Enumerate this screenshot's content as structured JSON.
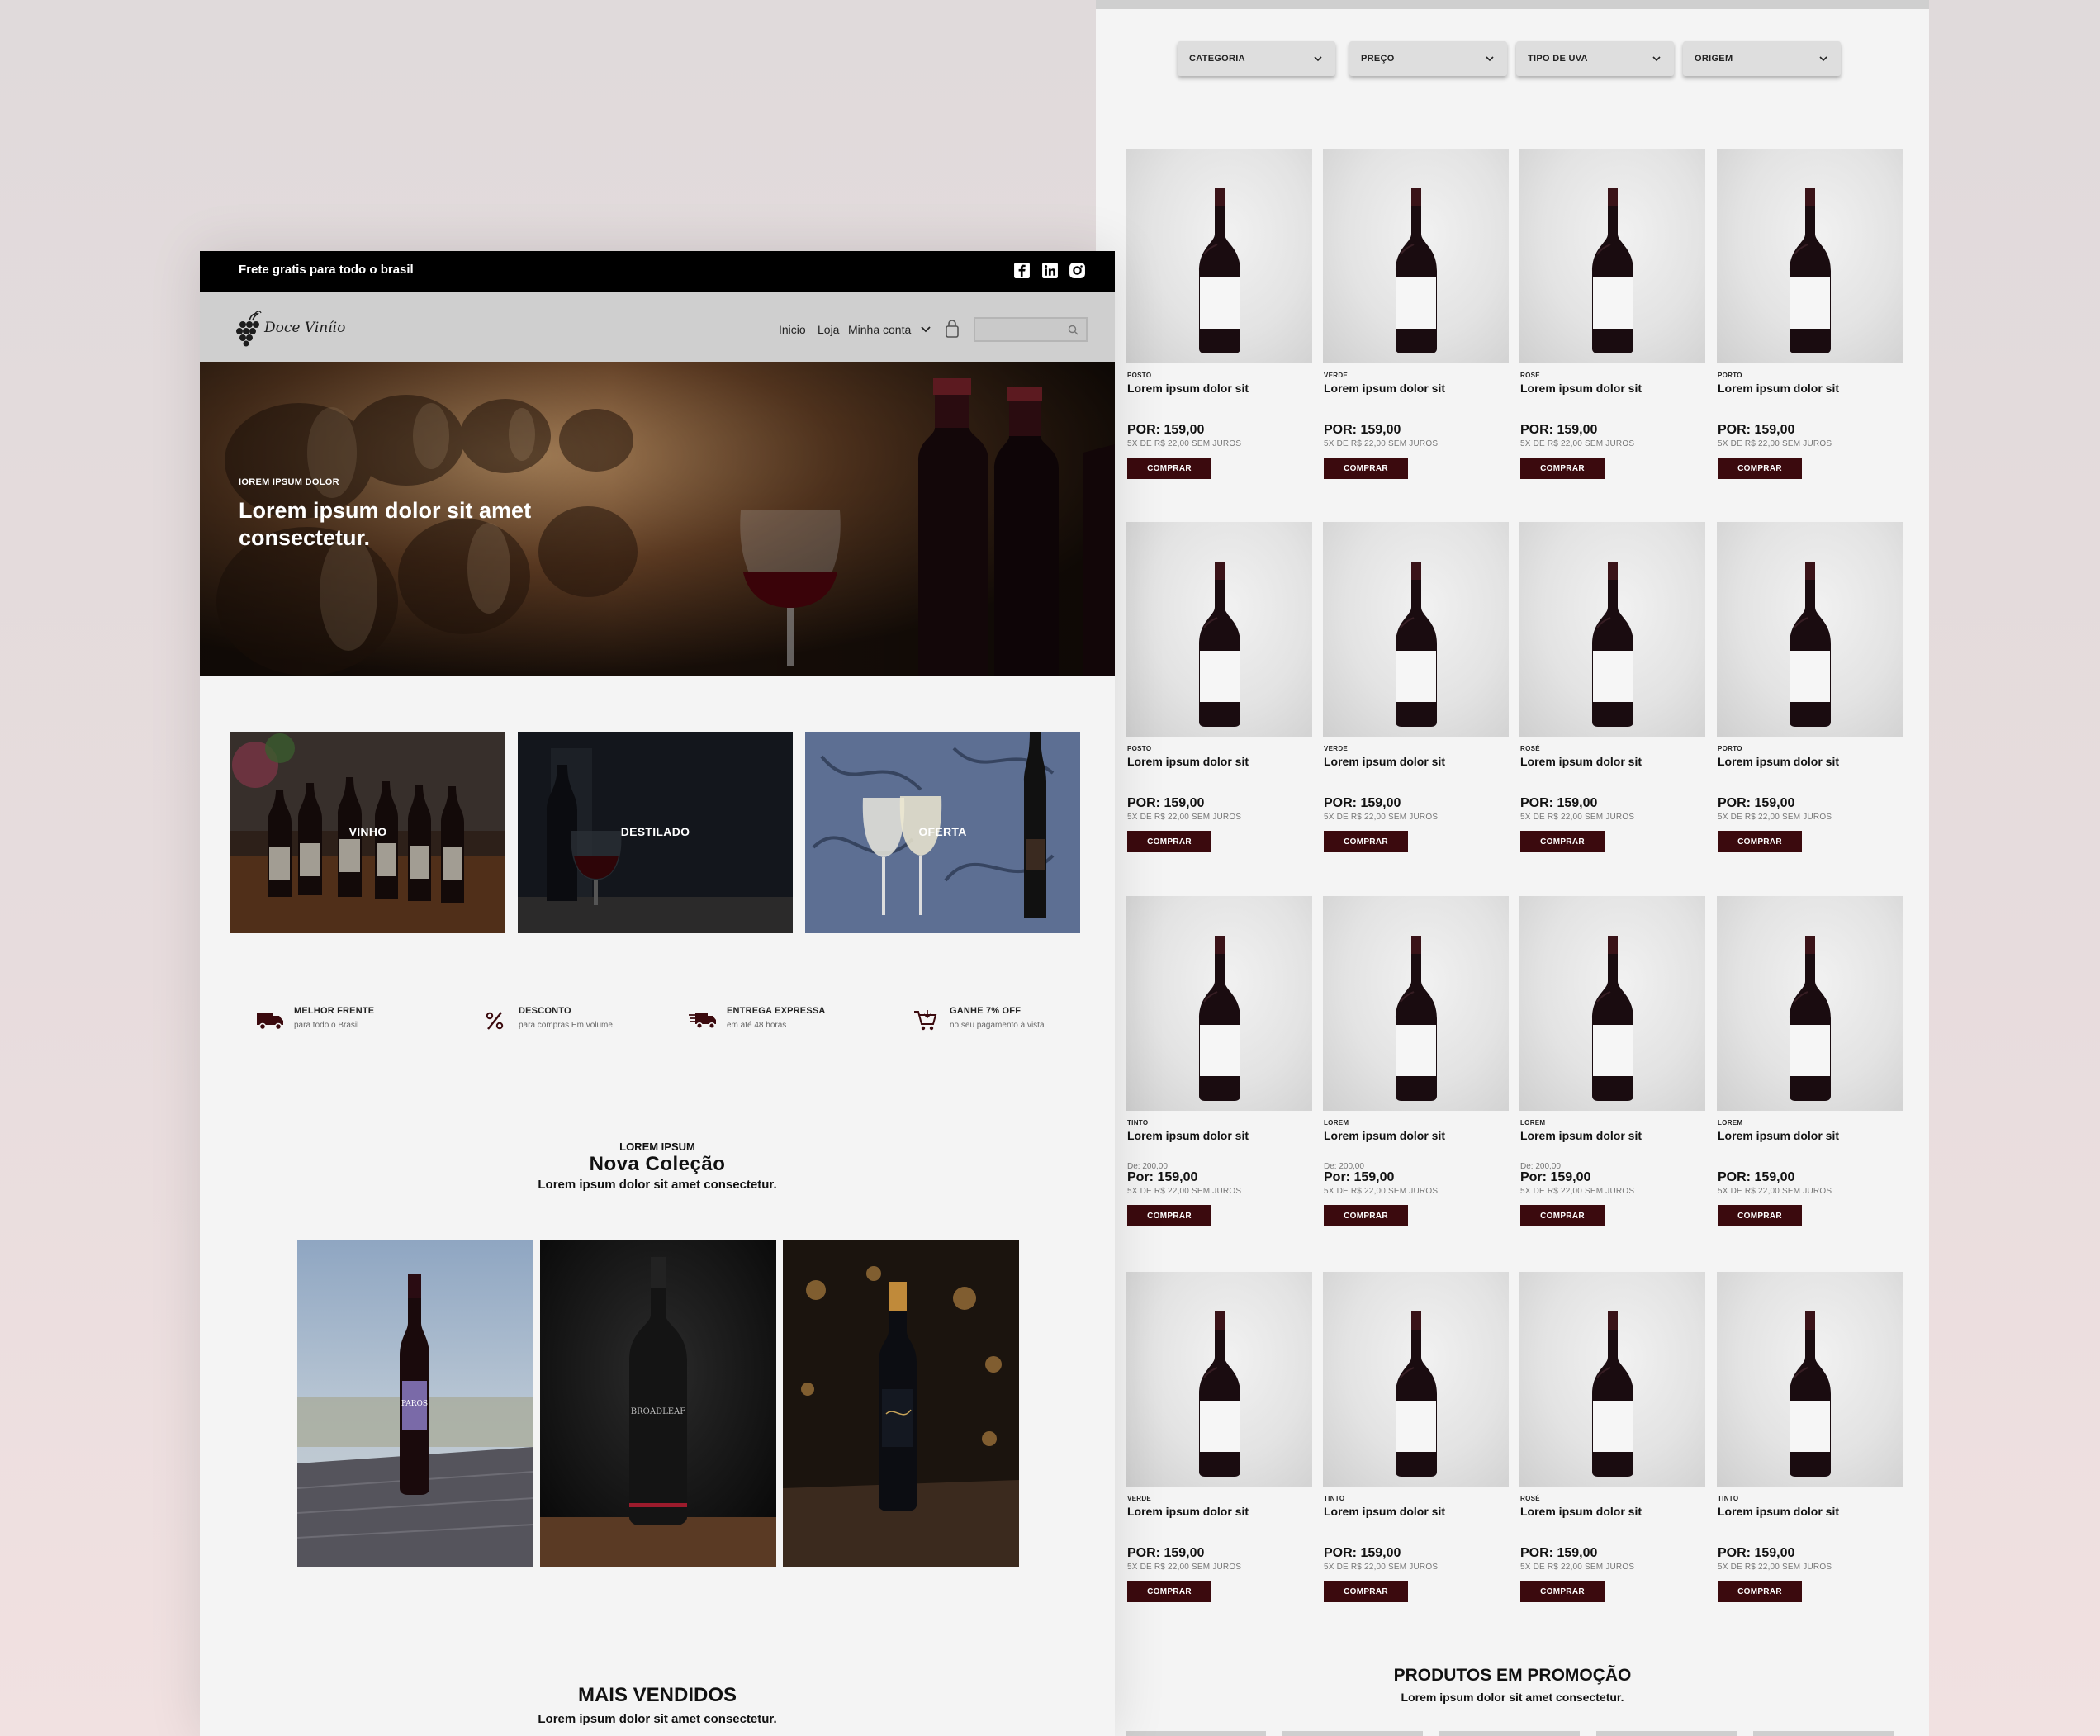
{
  "shop": {
    "filters": [
      {
        "label": "CATEGORIA"
      },
      {
        "label": "PREÇO"
      },
      {
        "label": "TIPO DE UVA"
      },
      {
        "label": "ORIGEM"
      }
    ],
    "buy_label": "COMPRAR",
    "installments": "5X DE R$ 22,00 SEM JUROS",
    "products": [
      {
        "category": "POSTO",
        "name": "Lorem ipsum dolor sit",
        "old_price": "",
        "price": "POR: 159,00"
      },
      {
        "category": "VERDE",
        "name": "Lorem ipsum dolor sit",
        "old_price": "",
        "price": "POR: 159,00"
      },
      {
        "category": "ROSÉ",
        "name": "Lorem ipsum dolor sit",
        "old_price": "",
        "price": "POR: 159,00"
      },
      {
        "category": "PORTO",
        "name": "Lorem ipsum dolor sit",
        "old_price": "",
        "price": "POR: 159,00"
      },
      {
        "category": "POSTO",
        "name": "Lorem ipsum dolor sit",
        "old_price": "",
        "price": "POR: 159,00"
      },
      {
        "category": "VERDE",
        "name": "Lorem ipsum dolor sit",
        "old_price": "",
        "price": "POR: 159,00"
      },
      {
        "category": "ROSÉ",
        "name": "Lorem ipsum dolor sit",
        "old_price": "",
        "price": "POR: 159,00"
      },
      {
        "category": "PORTO",
        "name": "Lorem ipsum dolor sit",
        "old_price": "",
        "price": "POR: 159,00"
      },
      {
        "category": "TINTO",
        "name": "Lorem ipsum dolor sit",
        "old_price": "De: 200,00",
        "price": "Por: 159,00"
      },
      {
        "category": "LOREM",
        "name": "Lorem ipsum dolor sit",
        "old_price": "De: 200,00",
        "price": "Por: 159,00"
      },
      {
        "category": "LOREM",
        "name": "Lorem ipsum dolor sit",
        "old_price": "De: 200,00",
        "price": "Por: 159,00"
      },
      {
        "category": "LOREM",
        "name": "Lorem ipsum dolor sit",
        "old_price": "",
        "price": "POR: 159,00"
      },
      {
        "category": "VERDE",
        "name": "Lorem ipsum dolor sit",
        "old_price": "",
        "price": "POR: 159,00"
      },
      {
        "category": "TINTO",
        "name": "Lorem ipsum dolor sit",
        "old_price": "",
        "price": "POR: 159,00"
      },
      {
        "category": "ROSÉ",
        "name": "Lorem ipsum dolor sit",
        "old_price": "",
        "price": "POR: 159,00"
      },
      {
        "category": "TINTO",
        "name": "Lorem ipsum dolor sit",
        "old_price": "",
        "price": "POR: 159,00"
      }
    ],
    "promo": {
      "title": "PRODUTOS EM PROMOÇÃO",
      "subtitle": "Lorem ipsum dolor sit amet consectetur."
    }
  },
  "home": {
    "topbar": {
      "text": "Frete gratis para todo o brasil",
      "social_icons": [
        "facebook-icon",
        "linkedin-icon",
        "instagram-icon"
      ]
    },
    "brand": "Doce Viníio",
    "nav": {
      "links": [
        "Inicio",
        "Loja",
        "Minha conta"
      ],
      "search_value": ""
    },
    "hero": {
      "kicker": "IOREM IPSUM DOLOR",
      "title": "Lorem ipsum dolor sit amet consectetur."
    },
    "categories": [
      {
        "label": "VINHO"
      },
      {
        "label": "DESTILADO"
      },
      {
        "label": "OFERTA"
      }
    ],
    "features": [
      {
        "icon": "truck-icon",
        "title": "MELHOR FRENTE",
        "subtitle": "para todo o Brasil"
      },
      {
        "icon": "percent-icon",
        "title": "DESCONTO",
        "subtitle": "para compras Em volume"
      },
      {
        "icon": "fast-truck-icon",
        "title": "ENTREGA EXPRESSA",
        "subtitle": "em até 48 horas"
      },
      {
        "icon": "cart-icon",
        "title": "GANHE 7% OFF",
        "subtitle": "no seu pagamento à vista"
      }
    ],
    "collection": {
      "kicker": "LOREM IPSUM",
      "title": "Nova  Coleção",
      "subtitle": "Lorem ipsum dolor sit amet consectetur.",
      "items": [
        {
          "label": "PAROS"
        },
        {
          "label": "BROADLEAF"
        },
        {
          "label": ""
        }
      ]
    },
    "best_sellers": {
      "title": "MAIS VENDIDOS",
      "subtitle": "Lorem ipsum dolor sit amet consectetur."
    }
  },
  "colors": {
    "accent": "#3b0a0e",
    "background": "#f4f4f4",
    "topbar": "#000000",
    "navbar": "#cfcfcf"
  }
}
